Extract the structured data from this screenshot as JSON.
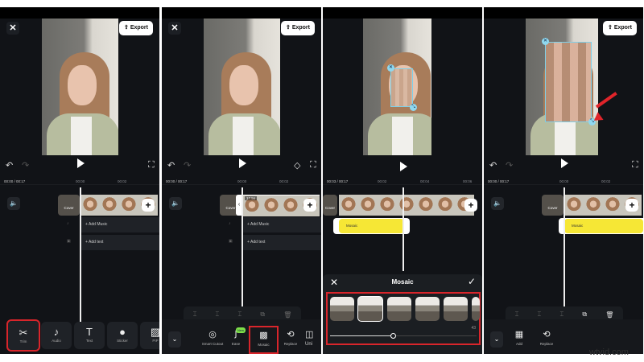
{
  "common": {
    "close_icon": "close-icon",
    "export_label": "Export",
    "undo_icon": "undo-icon",
    "redo_icon": "redo-icon",
    "play_icon": "play-icon",
    "fullscreen_icon": "fullscreen-icon",
    "cover_label": "Cover",
    "add_music": "Add Music",
    "add_text": "Add text",
    "plus": "+",
    "accent_red": "#d9252b",
    "mosaic_yellow": "#f6e735"
  },
  "panel1": {
    "time": "00:00 / 00:17",
    "ticks": [
      "00:00",
      "00:02"
    ],
    "toolbar": [
      {
        "label": "Trim",
        "icon": "scissors-icon"
      },
      {
        "label": "Audio",
        "icon": "music-note-icon"
      },
      {
        "label": "Text",
        "icon": "text-icon"
      },
      {
        "label": "Sticker",
        "icon": "sticker-icon"
      },
      {
        "label": "PIP",
        "icon": "pip-icon"
      }
    ]
  },
  "panel2": {
    "time": "00:00 / 00:17",
    "ticks": [
      "00:00",
      "00:02"
    ],
    "clip_duration": "17.5s",
    "toolbar": [
      {
        "label": "Smart Cutout",
        "icon": "smart-cutout-icon"
      },
      {
        "label": "Ease",
        "icon": "ease-icon",
        "badge": "New"
      },
      {
        "label": "Mosaic",
        "icon": "mosaic-icon"
      },
      {
        "label": "Replace",
        "icon": "replace-icon"
      },
      {
        "label": "Uni",
        "icon": "unite-icon"
      }
    ]
  },
  "panel3": {
    "time": "00:03 / 00:17",
    "ticks": [
      "00:02",
      "00:04",
      "00:06"
    ],
    "clip_label": "Mosaic",
    "sheet_title": "Mosaic",
    "confirm_icon": "check-icon",
    "slider_value": "43",
    "slider_fraction": 0.43,
    "selected_style": 2
  },
  "panel4": {
    "time": "00:00 / 00:17",
    "ticks": [
      "00:00",
      "00:02"
    ],
    "clip_label": "Mosaic",
    "toolbar": [
      {
        "label": "Add",
        "icon": "add-mosaic-icon"
      },
      {
        "label": "Replace",
        "icon": "replace-icon"
      }
    ]
  },
  "watermark": "wtvid.com"
}
